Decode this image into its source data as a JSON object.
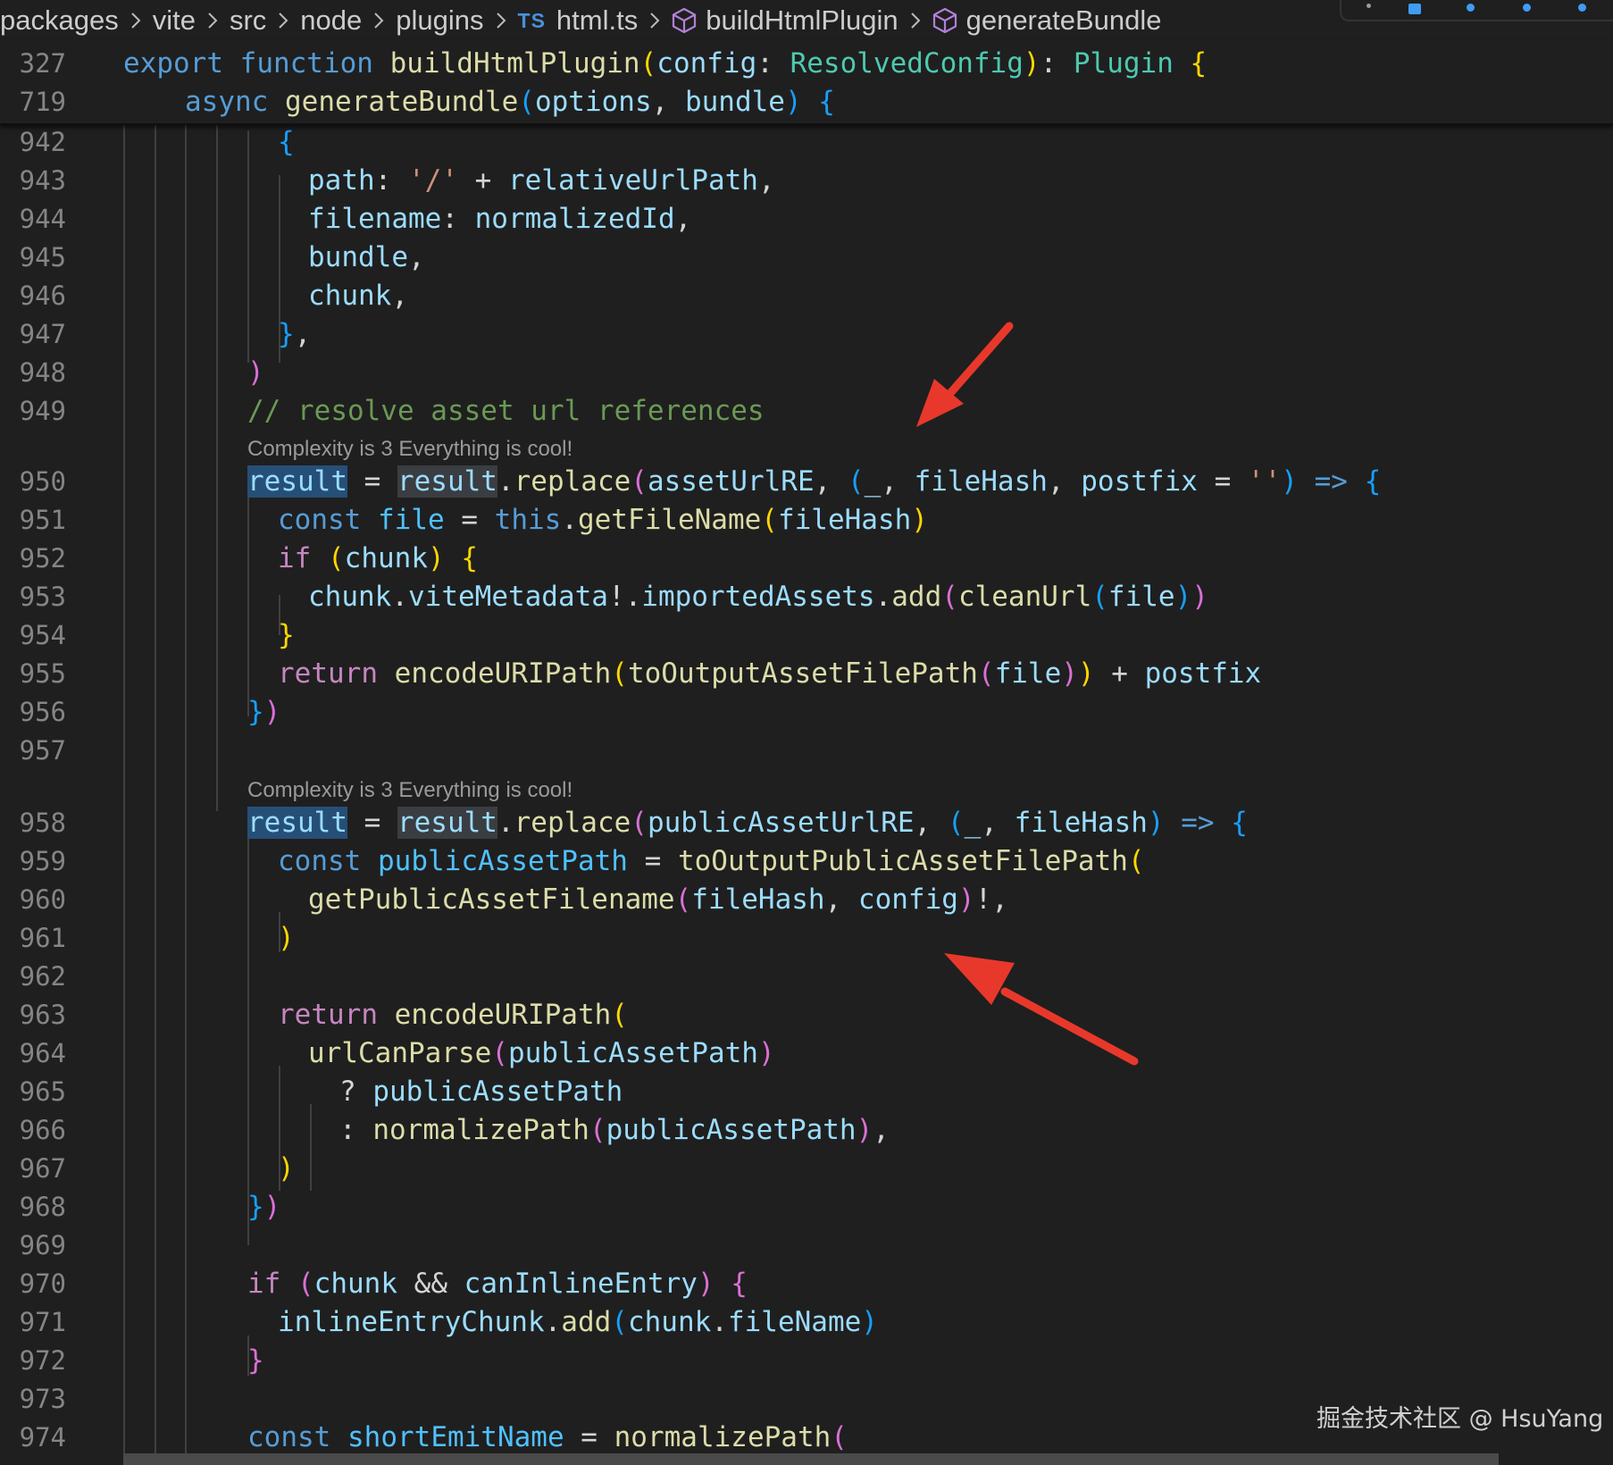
{
  "breadcrumb": {
    "items": [
      "packages",
      "vite",
      "src",
      "node",
      "plugins",
      "html.ts",
      "buildHtmlPlugin",
      "generateBundle"
    ],
    "file_badge": "TS"
  },
  "sticky_scroll": [
    {
      "line_number": "327",
      "code": "export function buildHtmlPlugin(config: ResolvedConfig): Plugin {"
    },
    {
      "line_number": "719",
      "code": "async generateBundle(options, bundle) {"
    }
  ],
  "codelens": {
    "text_1": "Complexity is 3 Everything is cool!",
    "text_2": "Complexity is 3 Everything is cool!"
  },
  "lines": [
    {
      "n": "942",
      "code": "{"
    },
    {
      "n": "943",
      "code": "path: '/' + relativeUrlPath,"
    },
    {
      "n": "944",
      "code": "filename: normalizedId,"
    },
    {
      "n": "945",
      "code": "bundle,"
    },
    {
      "n": "946",
      "code": "chunk,"
    },
    {
      "n": "947",
      "code": "},"
    },
    {
      "n": "948",
      "code": ")"
    },
    {
      "n": "949",
      "code": "// resolve asset url references"
    },
    {
      "n": "950",
      "code": "result = result.replace(assetUrlRE, (_, fileHash, postfix = '') => {"
    },
    {
      "n": "951",
      "code": "const file = this.getFileName(fileHash)"
    },
    {
      "n": "952",
      "code": "if (chunk) {"
    },
    {
      "n": "953",
      "code": "chunk.viteMetadata!.importedAssets.add(cleanUrl(file))"
    },
    {
      "n": "954",
      "code": "}"
    },
    {
      "n": "955",
      "code": "return encodeURIPath(toOutputAssetFilePath(file)) + postfix"
    },
    {
      "n": "956",
      "code": "})"
    },
    {
      "n": "957",
      "code": ""
    },
    {
      "n": "958",
      "code": "result = result.replace(publicAssetUrlRE, (_, fileHash) => {"
    },
    {
      "n": "959",
      "code": "const publicAssetPath = toOutputPublicAssetFilePath("
    },
    {
      "n": "960",
      "code": "getPublicAssetFilename(fileHash, config)!,"
    },
    {
      "n": "961",
      "code": ")"
    },
    {
      "n": "962",
      "code": ""
    },
    {
      "n": "963",
      "code": "return encodeURIPath("
    },
    {
      "n": "964",
      "code": "urlCanParse(publicAssetPath)"
    },
    {
      "n": "965",
      "code": "? publicAssetPath"
    },
    {
      "n": "966",
      "code": ": normalizePath(publicAssetPath),"
    },
    {
      "n": "967",
      "code": ")"
    },
    {
      "n": "968",
      "code": "})"
    },
    {
      "n": "969",
      "code": ""
    },
    {
      "n": "970",
      "code": "if (chunk && canInlineEntry) {"
    },
    {
      "n": "971",
      "code": "inlineEntryChunk.add(chunk.fileName)"
    },
    {
      "n": "972",
      "code": "}"
    },
    {
      "n": "973",
      "code": ""
    },
    {
      "n": "974",
      "code": "const shortEmitName = normalizePath("
    }
  ],
  "watermark": "掘金技术社区 @ HsuYang",
  "annotations": {
    "arrow_color": "#e8382b"
  },
  "theme": {
    "background": "#1f1f1f",
    "keyword": "#569cd6",
    "control": "#c586c0",
    "function": "#dcdcaa",
    "variable": "#9cdcfe",
    "type": "#4ec9b0",
    "string": "#ce9178",
    "comment": "#6a9955"
  }
}
